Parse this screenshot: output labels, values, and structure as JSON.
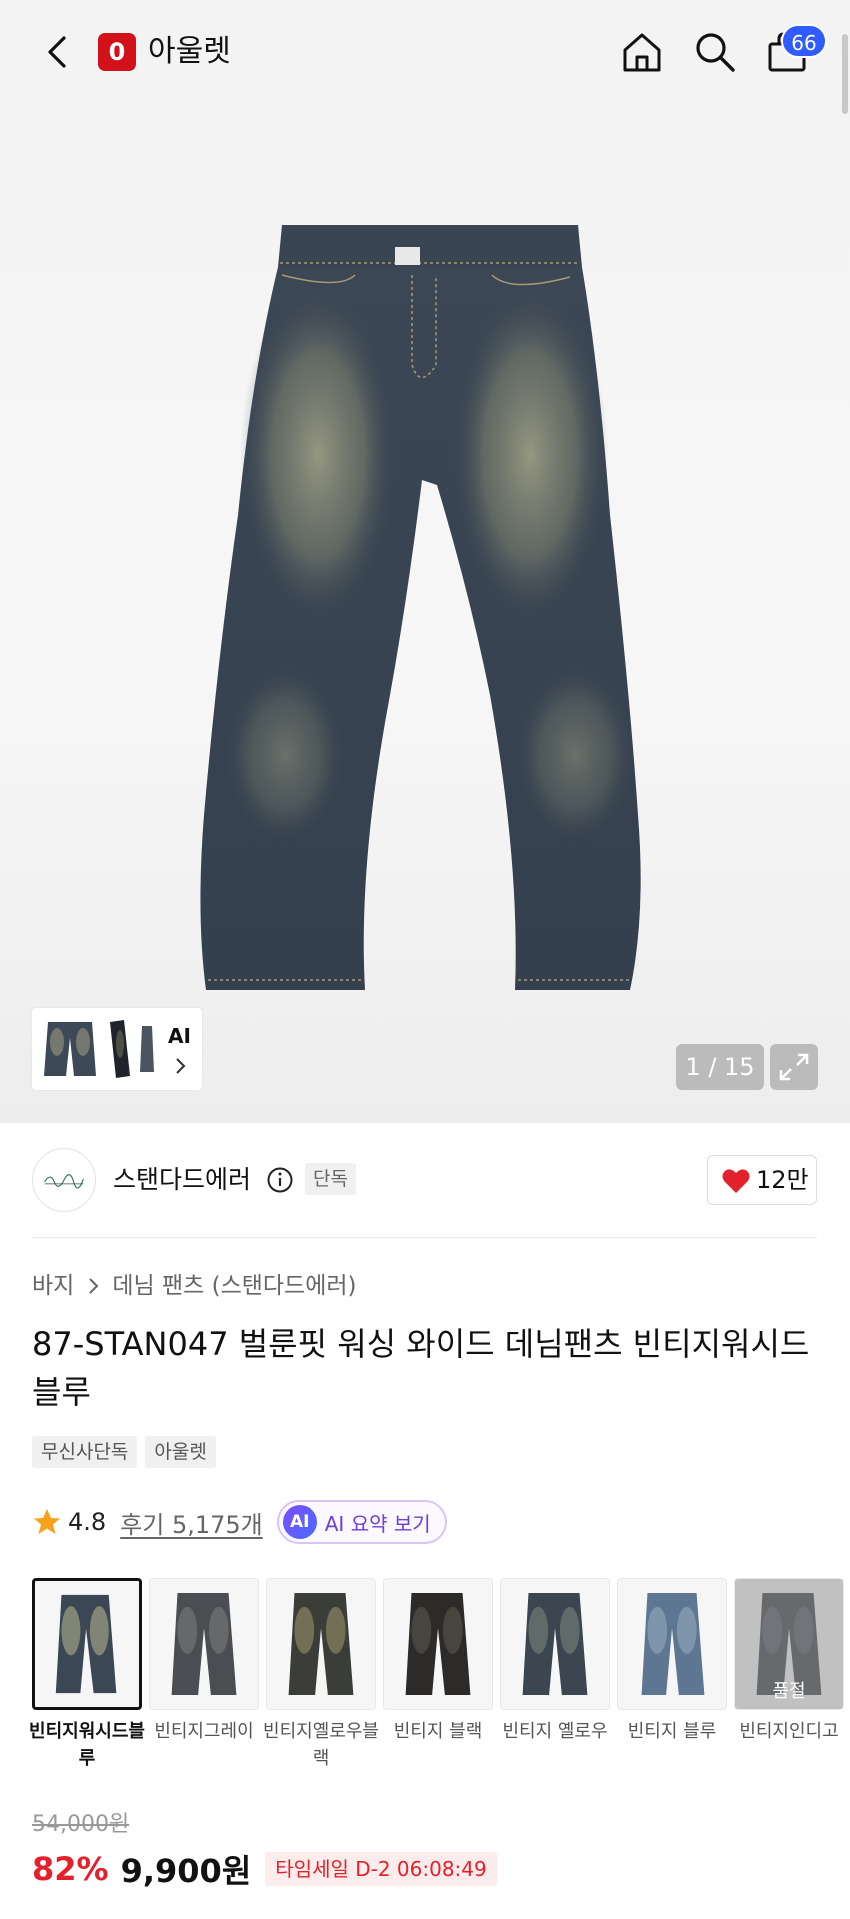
{
  "header": {
    "brand_logo_letter": "0",
    "brand_name": "아울렛",
    "cart_count": "66"
  },
  "gallery": {
    "thumb_ai_label": "AI",
    "counter": "1 / 15"
  },
  "seller": {
    "name": "스탠다드에러",
    "badge": "단독",
    "like_count": "12만"
  },
  "product": {
    "breadcrumb": [
      "바지",
      "데님 팬츠 (스탠다드에러)"
    ],
    "title": "87-STAN047 벌룬핏 워싱 와이드 데님팬츠 빈티지워시드블루",
    "tags": [
      "무신사단독",
      "아울렛"
    ],
    "rating": "4.8",
    "review_label": "후기 5,175개",
    "ai_badge": "AI",
    "ai_summary_label": "AI 요약 보기"
  },
  "color_options": [
    {
      "label": "빈티지워시드블루",
      "selected": true,
      "soldout": false
    },
    {
      "label": "빈티지그레이",
      "selected": false,
      "soldout": false
    },
    {
      "label": "빈티지옐로우블랙",
      "selected": false,
      "soldout": false
    },
    {
      "label": "빈티지 블랙",
      "selected": false,
      "soldout": false
    },
    {
      "label": "빈티지 옐로우",
      "selected": false,
      "soldout": false
    },
    {
      "label": "빈티지 블루",
      "selected": false,
      "soldout": false
    },
    {
      "label": "빈티지인디고",
      "selected": false,
      "soldout": true,
      "soldout_label": "품절"
    }
  ],
  "price": {
    "original": "54,000원",
    "discount": "82%",
    "sale": "9,900원",
    "timesale": "타임세일 D-2 06:08:49"
  },
  "colors": {
    "brand_red": "#d1121b",
    "badge_blue": "#2f5bff",
    "sale_red": "#e3212b",
    "heart_red": "#e3212b"
  }
}
